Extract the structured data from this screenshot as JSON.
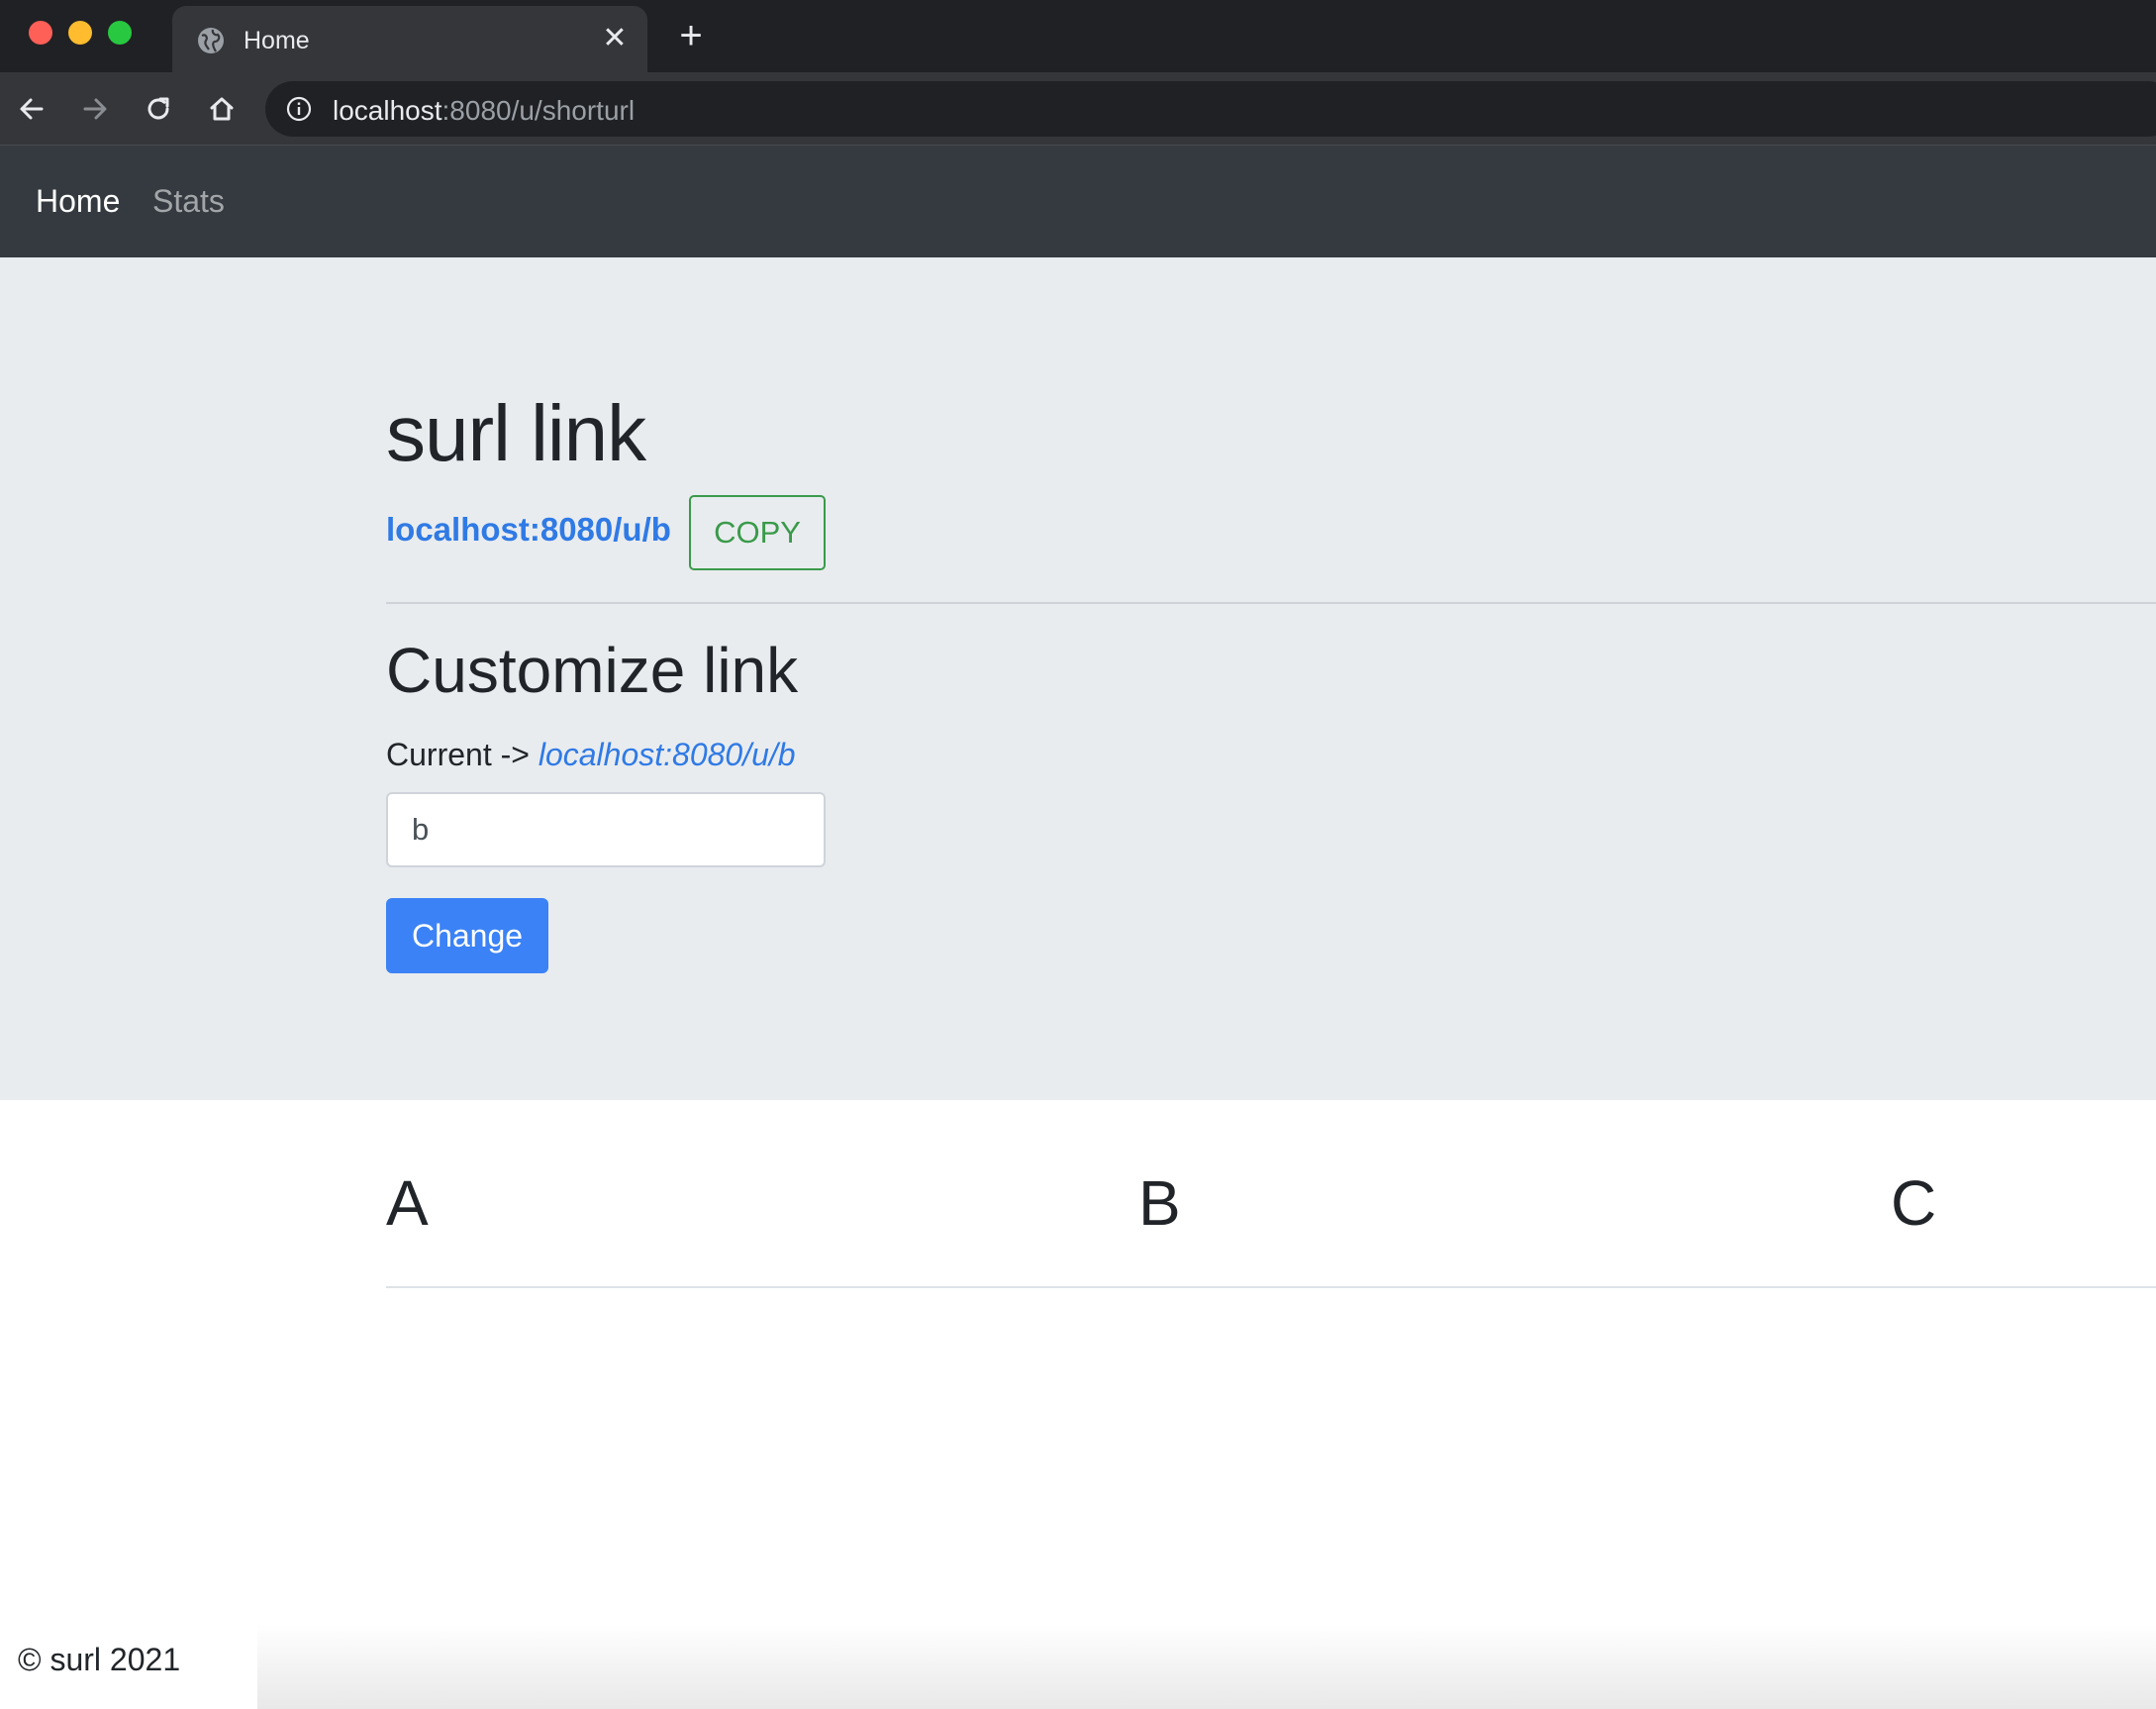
{
  "browser": {
    "tab_title": "Home",
    "tab_close_glyph": "✕",
    "new_tab_glyph": "+",
    "url_host": "localhost",
    "url_rest": ":8080/u/shorturl",
    "icons": [
      "back-icon",
      "forward-icon",
      "reload-icon",
      "home-icon",
      "info-icon",
      "globe-icon"
    ]
  },
  "navbar": {
    "home_label": "Home",
    "stats_label": "Stats"
  },
  "jumbotron": {
    "title": "surl link",
    "short_link": "localhost:8080/u/b",
    "copy_label": "COPY",
    "customize_title": "Customize link",
    "current_prefix": "Current ->",
    "current_link": "localhost:8080/u/b",
    "alias_value": "b",
    "change_label": "Change"
  },
  "columns": {
    "headers": [
      "A",
      "B",
      "C"
    ]
  },
  "footer": {
    "text": "© surl 2021"
  },
  "colors": {
    "navbar_bg": "#343a40",
    "jumbotron_bg": "#e9ecef",
    "link": "#2f7ae5",
    "copy_outline": "#3a9a4a",
    "primary_button": "#3b82f6"
  }
}
